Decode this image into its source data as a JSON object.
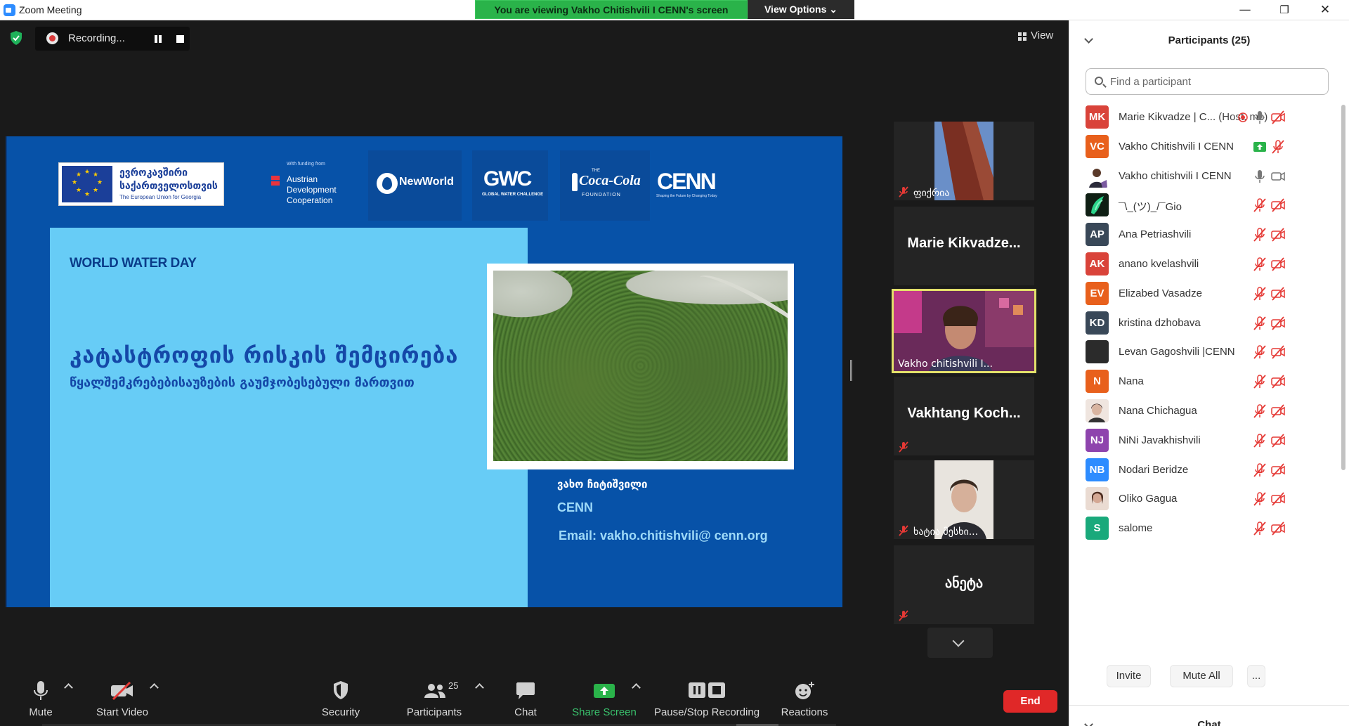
{
  "window": {
    "title": "Zoom Meeting",
    "minimize": "—",
    "restore": "❐",
    "close": "✕"
  },
  "banner": {
    "message": "You are viewing Vakho Chitishvili I CENN's screen",
    "view_options": "View Options ⌄"
  },
  "recording": {
    "label": "Recording..."
  },
  "view": {
    "label": "View"
  },
  "slide": {
    "eu_line1": "ევროკავშირი",
    "eu_line2": "საქართველოსთვის",
    "eu_line3": "The European Union for Georgia",
    "ada_small": "With funding from",
    "ada_line1": "Austrian",
    "ada_line2": "Development",
    "ada_line3": "Cooperation",
    "newworld": "NewWorld",
    "gwc": "GWC",
    "gwc_sub": "GLOBAL WATER CHALLENGE",
    "cc_the": "THE",
    "cocacola": "Coca-Cola",
    "cc_foundation": "FOUNDATION",
    "cenn": "CENN",
    "cenn_sub": "Shaping the Future by Changing Today",
    "event": "WORLD WATER DAY",
    "title_geo": "კატასტროფის რისკის შემცირება",
    "subtitle_geo": "წყალშემკრებებისაუზების გაუმჯობესებული მართვით",
    "author_geo": "ვახო ჩიტიშვილი",
    "author_org": "CENN",
    "author_email": "Email: vakho.chitishvili@ cenn.org"
  },
  "tiles": [
    {
      "type": "image",
      "label": "ფიქრია",
      "muted": true
    },
    {
      "type": "name",
      "name": "Marie  Kikvadze...",
      "muted": false
    },
    {
      "type": "image",
      "label": "Vakho chitishvili I...",
      "muted": false,
      "active": true
    },
    {
      "type": "name",
      "name": "Vakhtang  Koch...",
      "muted": true
    },
    {
      "type": "image",
      "label": "ხატია მესხი...",
      "muted": true
    },
    {
      "type": "name",
      "name": "ანეტა",
      "muted": true
    }
  ],
  "toolbar": {
    "mute": "Mute",
    "start_video": "Start Video",
    "security": "Security",
    "participants": "Participants",
    "participants_count": "25",
    "chat": "Chat",
    "share_screen": "Share Screen",
    "pause_stop_recording": "Pause/Stop Recording",
    "reactions": "Reactions",
    "end": "End"
  },
  "panel": {
    "title": "Participants (25)",
    "search_placeholder": "Find a participant",
    "participants": [
      {
        "initials": "MK",
        "color": "#d9433a",
        "name": "Marie Kikvadze | C...",
        "role": " (Host, me)",
        "icons": [
          "rec",
          "mic",
          "cam-off"
        ]
      },
      {
        "initials": "VC",
        "color": "#e8601c",
        "name": "Vakho Chitishvili I CENN",
        "role": "",
        "icons": [
          "share",
          "mic-off"
        ]
      },
      {
        "initials": "",
        "color": "#ffffff",
        "name": "Vakho chitishvili I CENN",
        "role": "",
        "icons": [
          "mic",
          "cam"
        ],
        "photo": "person"
      },
      {
        "initials": "",
        "color": "#1f2a1f",
        "name": "¯\\_(ツ)_/¯Gio",
        "role": "",
        "icons": [
          "mic-off",
          "cam-off"
        ],
        "photo": "green"
      },
      {
        "initials": "AP",
        "color": "#394858",
        "name": "Ana Petriashvili",
        "role": "",
        "icons": [
          "mic-off",
          "cam-off"
        ]
      },
      {
        "initials": "AK",
        "color": "#d9433a",
        "name": "anano kvelashvili",
        "role": "",
        "icons": [
          "mic-off",
          "cam-off"
        ]
      },
      {
        "initials": "EV",
        "color": "#e8601c",
        "name": "Elizabed Vasadze",
        "role": "",
        "icons": [
          "mic-off",
          "cam-off"
        ]
      },
      {
        "initials": "KD",
        "color": "#394858",
        "name": "kristina dzhobava",
        "role": "",
        "icons": [
          "mic-off",
          "cam-off"
        ]
      },
      {
        "initials": "",
        "color": "#2b2b2b",
        "name": "Levan Gagoshvili |CENN",
        "role": "",
        "icons": [
          "mic-off",
          "cam-off"
        ]
      },
      {
        "initials": "N",
        "color": "#e8601c",
        "name": "Nana",
        "role": "",
        "icons": [
          "mic-off",
          "cam-off"
        ]
      },
      {
        "initials": "",
        "color": "#f0e6e0",
        "name": "Nana Chichagua",
        "role": "",
        "icons": [
          "mic-off",
          "cam-off"
        ],
        "photo": "face"
      },
      {
        "initials": "NJ",
        "color": "#8e44ad",
        "name": "NiNi  Javakhishvili",
        "role": "",
        "icons": [
          "mic-off",
          "cam-off"
        ]
      },
      {
        "initials": "NB",
        "color": "#2d8cff",
        "name": "Nodari Beridze",
        "role": "",
        "icons": [
          "mic-off",
          "cam-off"
        ]
      },
      {
        "initials": "",
        "color": "#e9d6cc",
        "name": "Oliko Gagua",
        "role": "",
        "icons": [
          "mic-off",
          "cam-off"
        ],
        "photo": "face2"
      },
      {
        "initials": "S",
        "color": "#19a97b",
        "name": "salome",
        "role": "",
        "icons": [
          "mic-off",
          "cam-off"
        ]
      }
    ],
    "invite": "Invite",
    "mute_all": "Mute All",
    "more": "...",
    "chat_title": "Chat"
  }
}
